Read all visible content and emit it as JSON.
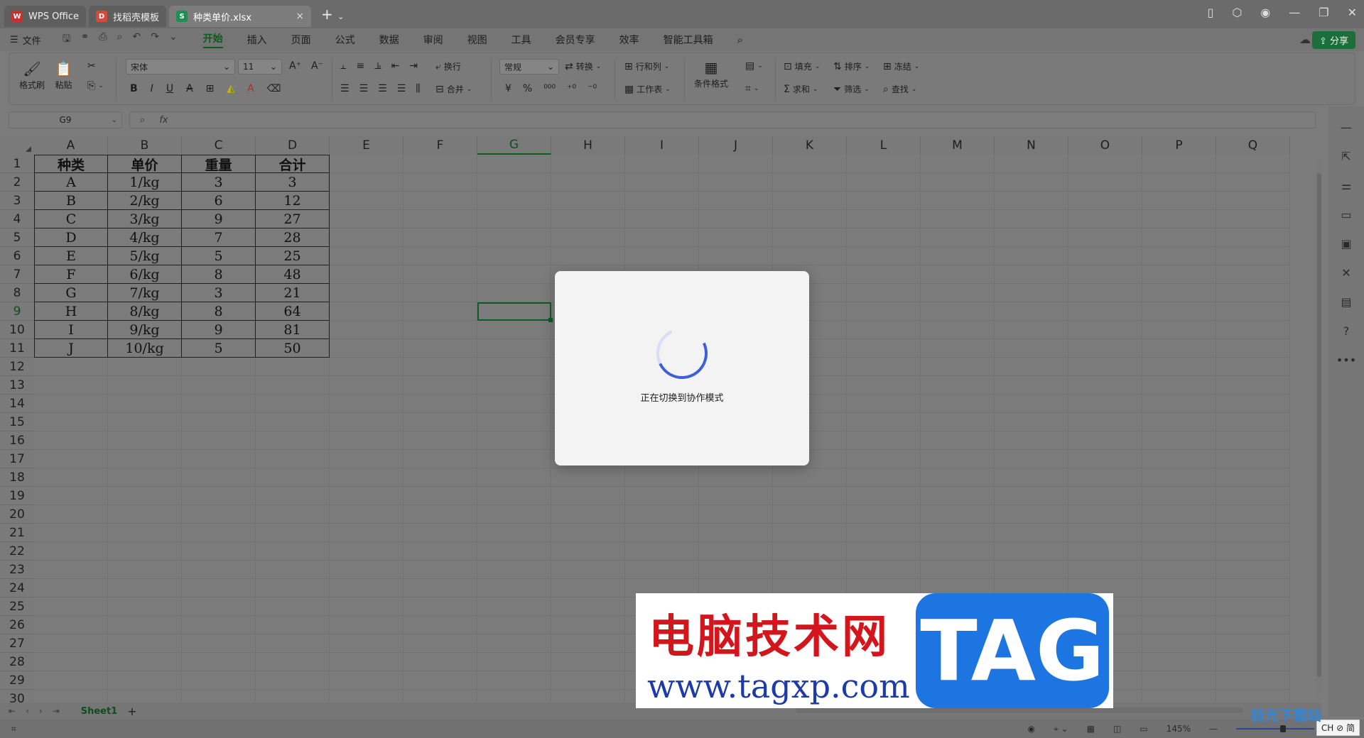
{
  "titlebar": {
    "tabs": [
      {
        "label": "WPS Office",
        "logo": "W"
      },
      {
        "label": "找稻壳模板",
        "logo": "D"
      },
      {
        "label": "种类单价.xlsx",
        "logo": "S"
      }
    ]
  },
  "menubar": {
    "file_label": "文件",
    "items": [
      "开始",
      "插入",
      "页面",
      "公式",
      "数据",
      "审阅",
      "视图",
      "工具",
      "会员专享",
      "效率",
      "智能工具箱"
    ],
    "share_label": "分享"
  },
  "ribbon": {
    "format_painter": "格式刷",
    "paste": "粘贴",
    "font_name": "宋体",
    "font_size": "11",
    "wrap": "换行",
    "merge": "合并",
    "number_format": "常规",
    "convert": "转换",
    "row_col": "行和列",
    "worksheet": "工作表",
    "cond_format": "条件格式",
    "fill": "填充",
    "sort": "排序",
    "freeze": "冻结",
    "sum": "求和",
    "filter": "筛选",
    "find": "查找"
  },
  "formula": {
    "name_box": "G9",
    "fx": "fx"
  },
  "columns": [
    "A",
    "B",
    "C",
    "D",
    "E",
    "F",
    "G",
    "H",
    "I",
    "J",
    "K",
    "L",
    "M",
    "N",
    "O",
    "P",
    "Q"
  ],
  "selected_column": "G",
  "selected_row": 9,
  "rows": [
    "1",
    "2",
    "3",
    "4",
    "5",
    "6",
    "7",
    "8",
    "9",
    "10",
    "11",
    "12",
    "13",
    "14",
    "15",
    "16",
    "17",
    "18",
    "19",
    "20",
    "21",
    "22",
    "23",
    "24",
    "25",
    "26",
    "27",
    "28",
    "29",
    "30"
  ],
  "table": {
    "header": [
      "种类",
      "单价",
      "重量",
      "合计"
    ],
    "data": [
      [
        "A",
        "1/kg",
        "3",
        "3"
      ],
      [
        "B",
        "2/kg",
        "6",
        "12"
      ],
      [
        "C",
        "3/kg",
        "9",
        "27"
      ],
      [
        "D",
        "4/kg",
        "7",
        "28"
      ],
      [
        "E",
        "5/kg",
        "5",
        "25"
      ],
      [
        "F",
        "6/kg",
        "8",
        "48"
      ],
      [
        "G",
        "7/kg",
        "3",
        "21"
      ],
      [
        "H",
        "8/kg",
        "8",
        "64"
      ],
      [
        "I",
        "9/kg",
        "9",
        "81"
      ],
      [
        "J",
        "10/kg",
        "5",
        "50"
      ]
    ]
  },
  "sheets": {
    "active": "Sheet1",
    "add": "+"
  },
  "status": {
    "zoom": "145%",
    "ime": "CH ⊘ 简"
  },
  "modal": {
    "message": "正在切换到协作模式"
  },
  "watermark": {
    "cn": "电脑技术网",
    "url": "www.tagxp.com",
    "tag": "TAG"
  },
  "corner_logo": {
    "text": "极光下载站"
  }
}
